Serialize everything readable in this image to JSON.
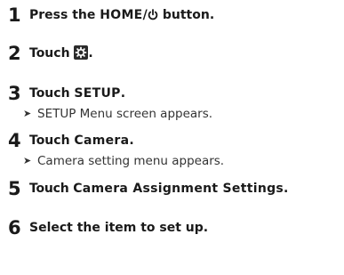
{
  "steps": [
    {
      "number": "1",
      "text_before": "Press the ",
      "keyword": "HOME",
      "separator": "/",
      "power_icon": "power-icon",
      "text_after": " button."
    },
    {
      "number": "2",
      "text_before": "Touch ",
      "icon": "settings-icon",
      "text_after": "."
    },
    {
      "number": "3",
      "text_before": "Touch ",
      "keyword": "SETUP",
      "text_after": ".",
      "result": "SETUP Menu screen appears."
    },
    {
      "number": "4",
      "text_before": "Touch ",
      "keyword": "Camera",
      "text_after": ".",
      "result": "Camera setting menu appears."
    },
    {
      "number": "5",
      "text_before": "Touch ",
      "keyword": "Camera Assignment Settings",
      "text_after": "."
    },
    {
      "number": "6",
      "text": "Select the item to set up."
    }
  ],
  "result_marker": "➤"
}
